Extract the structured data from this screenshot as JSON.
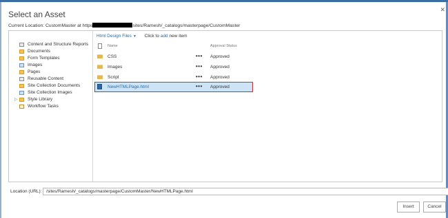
{
  "dialog": {
    "title": "Select an Asset",
    "close_icon": "close-icon"
  },
  "current_location": {
    "prefix": "Current Location: CustomMaster at https",
    "suffix": "sites/Ramesh/_catalogs/masterpage/CustomMaster"
  },
  "tree": {
    "items": [
      {
        "label": "Content and Structure Reports",
        "icon": "list-icon"
      },
      {
        "label": "Documents",
        "icon": "document-library-icon"
      },
      {
        "label": "Form Templates",
        "icon": "document-library-icon"
      },
      {
        "label": "Images",
        "icon": "picture-library-icon"
      },
      {
        "label": "Pages",
        "icon": "pages-library-icon"
      },
      {
        "label": "Reusable Content",
        "icon": "list-icon"
      },
      {
        "label": "Site Collection Documents",
        "icon": "document-library-icon"
      },
      {
        "label": "Site Collection Images",
        "icon": "picture-library-icon"
      },
      {
        "label": "Style Library",
        "icon": "document-library-icon",
        "expander": "▷"
      },
      {
        "label": "Workflow Tasks",
        "icon": "task-list-icon"
      }
    ]
  },
  "toolbar": {
    "view_label": "Html Design Files",
    "caret": "▼",
    "add_prefix": "Click to",
    "add_link": "add",
    "add_suffix": "new item"
  },
  "list": {
    "headers": {
      "name": "Name",
      "status": "Approval Status"
    },
    "rows": [
      {
        "name": "CSS",
        "dots": "•••",
        "status": "Approved",
        "type": "folder"
      },
      {
        "name": "Images",
        "dots": "•••",
        "status": "Approved",
        "type": "folder"
      },
      {
        "name": "Script",
        "dots": "•••",
        "status": "Approved",
        "type": "folder"
      },
      {
        "name": "NewHTMLPage.html",
        "dots": "•••",
        "status": "Approved",
        "type": "file",
        "selected": true
      }
    ]
  },
  "location": {
    "label": "Location (URL):",
    "value": "/sites/Ramesh/_catalogs/masterpage/CustomMaster/NewHTMLPage.html"
  },
  "buttons": {
    "insert": "Insert",
    "cancel": "Cancel"
  },
  "colors": {
    "accent": "#1f6bb5",
    "selection_bg": "#cde4f6",
    "selection_border": "#e0242a",
    "folder": "#e8b64c"
  }
}
